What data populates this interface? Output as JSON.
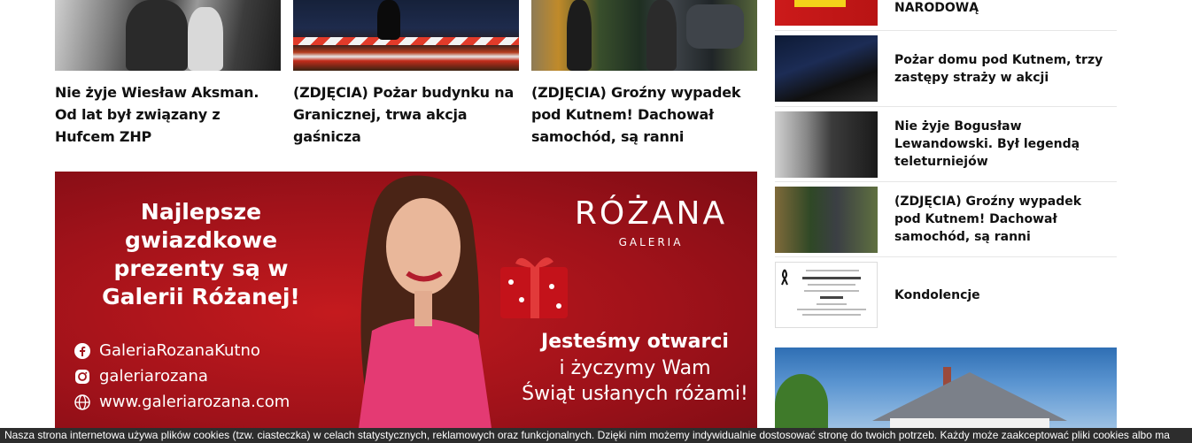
{
  "articles": [
    {
      "title": "Nie żyje Wiesław Aksman. Od lat był związany z Hufcem ZHP"
    },
    {
      "title": "(ZDJĘCIA) Pożar budynku na Granicznej, trwa akcja gaśnicza"
    },
    {
      "title": "(ZDJĘCIA) Groźny wypadek pod Kutnem! Dachował samochód, są ranni"
    }
  ],
  "banner": {
    "headline": "Najlepsze gwiazdkowe prezenty są w Galerii Różanej!",
    "brand": "RÓŻANA",
    "brand_sub": "GALERIA",
    "social": {
      "facebook": "GaleriaRozanaKutno",
      "instagram": "galeriarozana",
      "website": "www.galeriarozana.com"
    },
    "open_line1": "Jesteśmy otwarci",
    "open_line2": "i życzymy Wam",
    "open_line3": "Świąt usłanych różami!",
    "colors": {
      "background": "#a0121a",
      "text": "#ffffff"
    }
  },
  "sidebar": {
    "top_item": {
      "title": "NARODOWĄ"
    },
    "items": [
      {
        "title": "Pożar domu pod Kutnem, trzy zastępy straży w akcji"
      },
      {
        "title": "Nie żyje Bogusław Lewandowski. Był legendą teleturniejów"
      },
      {
        "title": "(ZDJĘCIA) Groźny wypadek pod Kutnem! Dachował samochód, są ranni"
      },
      {
        "title": "Kondolencje"
      }
    ]
  },
  "cookie": {
    "text": "Nasza strona internetowa używa plików cookies (tzw. ciasteczka) w celach statystycznych, reklamowych oraz funkcjonalnych. Dzięki nim możemy indywidualnie dostosować stronę do twoich potrzeb. Każdy może zaakceptować pliki cookies albo ma"
  }
}
